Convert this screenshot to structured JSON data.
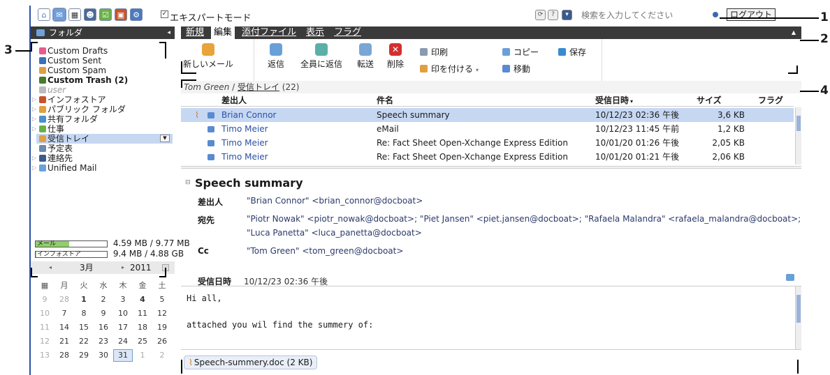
{
  "topbar": {
    "expert_mode_label": "エキスパートモード",
    "expert_checked": "✓",
    "search_placeholder": "検索を入力してください",
    "logout_label": "ログアウト"
  },
  "sidebar": {
    "title": "フォルダ",
    "folders": [
      {
        "label": "Custom Drafts",
        "style": "normal"
      },
      {
        "label": "Custom Sent",
        "style": "normal"
      },
      {
        "label": "Custom Spam",
        "style": "normal"
      },
      {
        "label": "Custom Trash (2)",
        "style": "bold"
      },
      {
        "label": "user",
        "style": "gray"
      },
      {
        "label": "インフォストア",
        "style": "normal"
      },
      {
        "label": "パブリック フォルダ",
        "style": "normal"
      },
      {
        "label": "共有フォルダ",
        "style": "normal"
      },
      {
        "label": "仕事",
        "style": "normal"
      },
      {
        "label": "受信トレイ",
        "style": "selected"
      },
      {
        "label": "予定表",
        "style": "normal"
      },
      {
        "label": "連絡先",
        "style": "normal"
      },
      {
        "label": "Unified Mail",
        "style": "normal"
      }
    ],
    "quota_mail_label": "メール",
    "quota_mail_value": "4.59 MB / 9.77 MB",
    "quota_mail_fraction": 0.47,
    "quota_infostore_label": "インフォストア",
    "quota_infostore_value": "9.4 MB / 4.88 GB",
    "quota_infostore_fraction": 0.002
  },
  "calendar": {
    "month": "3月",
    "year": "2011",
    "weekdays": [
      "月",
      "火",
      "水",
      "木",
      "金",
      "土"
    ],
    "weeks": [
      {
        "wk": "9",
        "days": [
          "28",
          "1",
          "2",
          "3",
          "4",
          "5"
        ]
      },
      {
        "wk": "10",
        "days": [
          "7",
          "8",
          "9",
          "10",
          "11",
          "12"
        ]
      },
      {
        "wk": "11",
        "days": [
          "14",
          "15",
          "16",
          "17",
          "18",
          "19"
        ]
      },
      {
        "wk": "12",
        "days": [
          "21",
          "22",
          "23",
          "24",
          "25",
          "26"
        ]
      },
      {
        "wk": "13",
        "days": [
          "28",
          "29",
          "30",
          "31",
          "1",
          "2"
        ]
      }
    ]
  },
  "main": {
    "tabs": [
      "新規",
      "編集",
      "添付ファイル",
      "表示",
      "フラグ"
    ],
    "ribbon": {
      "new_mail": "新しいメール",
      "reply": "返信",
      "reply_all": "全員に返信",
      "forward": "転送",
      "delete": "削除",
      "print": "印刷",
      "mark": "印を付ける",
      "copy": "コピー",
      "move": "移動",
      "save": "保存"
    },
    "breadcrumb_user": "Tom Green",
    "breadcrumb_sep": " / ",
    "breadcrumb_folder": "受信トレイ",
    "breadcrumb_count": " (22)",
    "columns": {
      "from": "差出人",
      "subject": "件名",
      "received": "受信日時",
      "size": "サイズ",
      "flag": "フラグ"
    },
    "messages": [
      {
        "from": "Brian Connor",
        "subject": "Speech summary",
        "received": "10/12/23 02:36 午後",
        "size": "3,6 KB"
      },
      {
        "from": "Timo Meier",
        "subject": "eMail",
        "received": "10/12/23 11:45 午前",
        "size": "1,2 KB"
      },
      {
        "from": "Timo Meier",
        "subject": "Re: Fact Sheet Open-Xchange Express Edition",
        "received": "10/01/20 01:26 午後",
        "size": "2,05 KB"
      },
      {
        "from": "Timo Meier",
        "subject": "Re: Fact Sheet Open-Xchange Express Edition",
        "received": "10/01/20 01:21 午後",
        "size": "2,06 KB"
      }
    ]
  },
  "preview": {
    "subject": "Speech summary",
    "from_label": "差出人",
    "from_value": "\"Brian Connor\" <brian_connor@docboat>",
    "to_label": "宛先",
    "to_value_line1": "\"Piotr Nowak\" <piotr_nowak@docboat>; \"Piet Jansen\" <piet.jansen@docboat>; \"Rafaela Malandra\" <rafaela_malandra@docboat>;",
    "to_value_line2": "\"Luca Panetta\" <luca_panetta@docboat>",
    "cc_label": "Cc",
    "cc_value": "\"Tom Green\" <tom_green@docboat>",
    "received_label": "受信日時",
    "received_value": "10/12/23 02:36 午後",
    "body_line1": "Hi all,",
    "body_line2": "attached you wil find the summery of:",
    "attachment": "Speech-summery.doc (2 KB)"
  },
  "callouts": [
    "1",
    "2",
    "3",
    "4"
  ]
}
